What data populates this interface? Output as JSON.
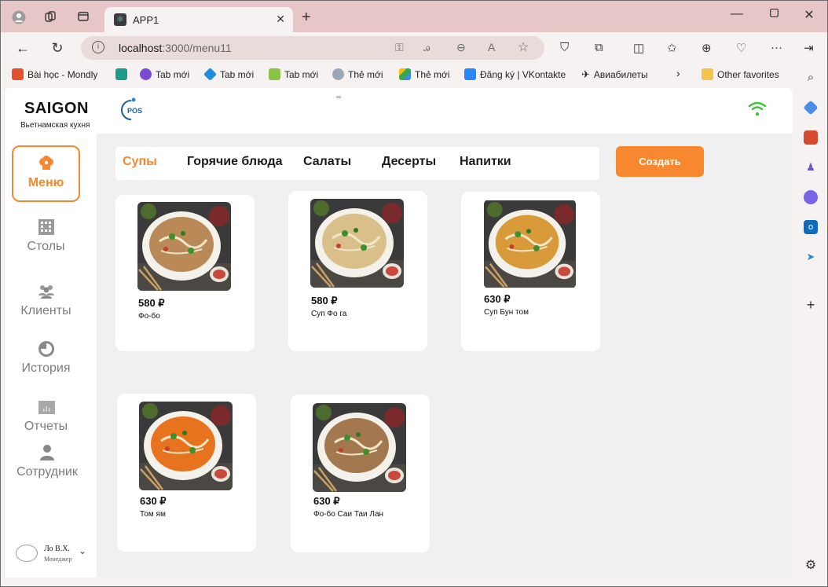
{
  "browser": {
    "tab_title": "APP1",
    "url_host": "localhost",
    "url_rest": ":3000/menu11",
    "favorites": [
      {
        "label": "Bài học - Mondly",
        "color": "#e0522b"
      },
      {
        "label": "",
        "color": "#1c9b8a"
      },
      {
        "label": "Tab mới",
        "color": "#7a4bd1"
      },
      {
        "label": "Tab mới",
        "color": "#1e8fd8"
      },
      {
        "label": "Tab mới",
        "color": "#8bc34a"
      },
      {
        "label": "Thẻ mới",
        "color": "#9aa7b5"
      },
      {
        "label": "Thẻ mới",
        "color": "#34a853"
      },
      {
        "label": "Đăng ký | VKontakte",
        "color": "#2787f5"
      },
      {
        "label": "Авиабилеты",
        "color": "#f4b400"
      }
    ],
    "other_favorites": "Other favorites"
  },
  "app": {
    "brand": "SAIGON",
    "brand_sub": "Вьетнамская кухня",
    "logo_text": "POS",
    "accent": "#f7882f",
    "sidebar": [
      {
        "label": "Меню",
        "icon": "chef-hat-icon",
        "active": true
      },
      {
        "label": "Столы",
        "icon": "table-grid-icon",
        "active": false
      },
      {
        "label": "Клиенты",
        "icon": "users-icon",
        "active": false
      },
      {
        "label": "История",
        "icon": "history-icon",
        "active": false
      },
      {
        "label": "Отчеты",
        "icon": "chart-icon",
        "active": false
      },
      {
        "label": "Сотрудник",
        "icon": "user-icon",
        "active": false
      }
    ],
    "user": {
      "name": "Ло В.Х.",
      "role": "Менеджер"
    },
    "categories": [
      "Супы",
      "Горячие блюда",
      "Салаты",
      "Десерты",
      "Напитки"
    ],
    "active_category": "Супы",
    "create_label": "Создать",
    "items": [
      {
        "price": "580 ₽",
        "name": "Фо-бо",
        "soup": "#b98a58"
      },
      {
        "price": "580 ₽",
        "name": "Суп Фо га",
        "soup": "#d9c08a"
      },
      {
        "price": "630 ₽",
        "name": "Суп Бун том",
        "soup": "#d99a3a"
      },
      {
        "price": "630 ₽",
        "name": "Том ям",
        "soup": "#e8731e"
      },
      {
        "price": "630 ₽",
        "name": "Фо-бо Саи Таи Лан",
        "soup": "#a4784e"
      }
    ]
  }
}
